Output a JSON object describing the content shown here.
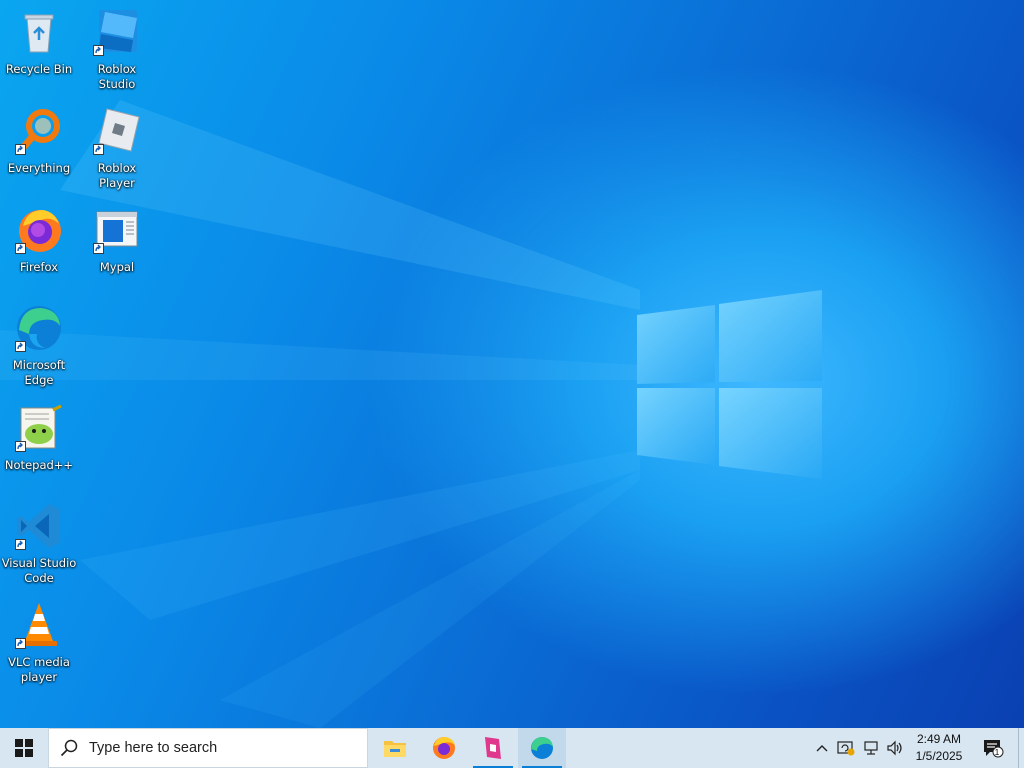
{
  "desktop": {
    "icons": [
      {
        "label": "Recycle Bin",
        "icon": "recycle-bin-icon"
      },
      {
        "label": "Roblox Studio",
        "icon": "roblox-studio-icon"
      },
      {
        "label": "Everything",
        "icon": "everything-search-icon"
      },
      {
        "label": "Roblox Player",
        "icon": "roblox-player-icon"
      },
      {
        "label": "Firefox",
        "icon": "firefox-icon"
      },
      {
        "label": "Mypal",
        "icon": "mypal-icon"
      },
      {
        "label": "Microsoft Edge",
        "icon": "edge-icon"
      },
      {
        "label": "Notepad++",
        "icon": "notepad-plus-plus-icon"
      },
      {
        "label": "Visual Studio Code",
        "icon": "vscode-icon"
      },
      {
        "label": "VLC media player",
        "icon": "vlc-icon"
      }
    ]
  },
  "taskbar": {
    "search_placeholder": "Type here to search",
    "pinned_apps": [
      {
        "name": "File Explorer",
        "icon": "file-explorer-icon"
      },
      {
        "name": "Firefox",
        "icon": "firefox-icon"
      },
      {
        "name": "Roblox Studio",
        "icon": "roblox-studio-icon",
        "running": true
      },
      {
        "name": "Microsoft Edge",
        "icon": "edge-icon",
        "running": true,
        "active": true
      }
    ],
    "clock": {
      "time": "2:49 AM",
      "date": "1/5/2025"
    },
    "notification_count": "1"
  },
  "colors": {
    "taskbar_bg": "#d7e6f1",
    "accent": "#0b7fd6",
    "wallpaper_blue": "#0a78e0"
  }
}
